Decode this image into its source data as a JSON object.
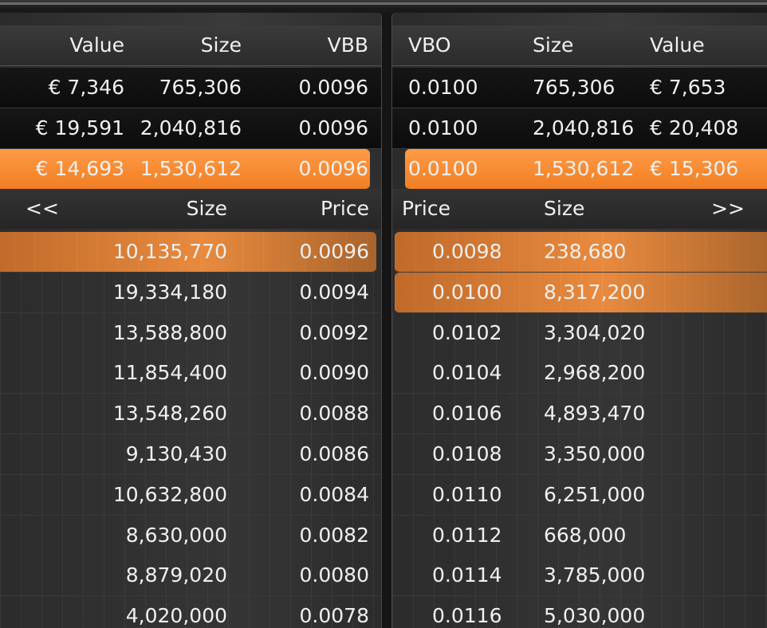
{
  "bid": {
    "summary_headers": {
      "value": "Value",
      "size": "Size",
      "price": "VBB"
    },
    "summary_rows": [
      {
        "value": "€ 7,346",
        "size": "765,306",
        "price": "0.0096",
        "highlighted": false
      },
      {
        "value": "€ 19,591",
        "size": "2,040,816",
        "price": "0.0096",
        "highlighted": false
      },
      {
        "value": "€ 14,693",
        "size": "1,530,612",
        "price": "0.0096",
        "highlighted": true
      }
    ],
    "book_headers": {
      "nav": "<<",
      "size": "Size",
      "price": "Price"
    },
    "book_rows": [
      {
        "size": "10,135,770",
        "price": "0.0096",
        "highlighted": true
      },
      {
        "size": "19,334,180",
        "price": "0.0094",
        "highlighted": false
      },
      {
        "size": "13,588,800",
        "price": "0.0092",
        "highlighted": false
      },
      {
        "size": "11,854,400",
        "price": "0.0090",
        "highlighted": false
      },
      {
        "size": "13,548,260",
        "price": "0.0088",
        "highlighted": false
      },
      {
        "size": "9,130,430",
        "price": "0.0086",
        "highlighted": false
      },
      {
        "size": "10,632,800",
        "price": "0.0084",
        "highlighted": false
      },
      {
        "size": "8,630,000",
        "price": "0.0082",
        "highlighted": false
      },
      {
        "size": "8,879,020",
        "price": "0.0080",
        "highlighted": false
      },
      {
        "size": "4,020,000",
        "price": "0.0078",
        "highlighted": false
      }
    ]
  },
  "ask": {
    "summary_headers": {
      "price": "VBO",
      "size": "Size",
      "value": "Value"
    },
    "summary_rows": [
      {
        "price": "0.0100",
        "size": "765,306",
        "value": "€ 7,653",
        "highlighted": false
      },
      {
        "price": "0.0100",
        "size": "2,040,816",
        "value": "€ 20,408",
        "highlighted": false
      },
      {
        "price": "0.0100",
        "size": "1,530,612",
        "value": "€ 15,306",
        "highlighted": true
      }
    ],
    "book_headers": {
      "price": "Price",
      "size": "Size",
      "nav": ">>"
    },
    "book_rows": [
      {
        "price": "0.0098",
        "size": "238,680",
        "highlighted": true
      },
      {
        "price": "0.0100",
        "size": "8,317,200",
        "highlighted": true
      },
      {
        "price": "0.0102",
        "size": "3,304,020",
        "highlighted": false
      },
      {
        "price": "0.0104",
        "size": "2,968,200",
        "highlighted": false
      },
      {
        "price": "0.0106",
        "size": "4,893,470",
        "highlighted": false
      },
      {
        "price": "0.0108",
        "size": "3,350,000",
        "highlighted": false
      },
      {
        "price": "0.0110",
        "size": "6,251,000",
        "highlighted": false
      },
      {
        "price": "0.0112",
        "size": "668,000",
        "highlighted": false
      },
      {
        "price": "0.0114",
        "size": "3,785,000",
        "highlighted": false
      },
      {
        "price": "0.0116",
        "size": "5,030,000",
        "highlighted": false
      }
    ]
  },
  "colors": {
    "highlight": "#f5862b",
    "background": "#1a1a1a"
  }
}
